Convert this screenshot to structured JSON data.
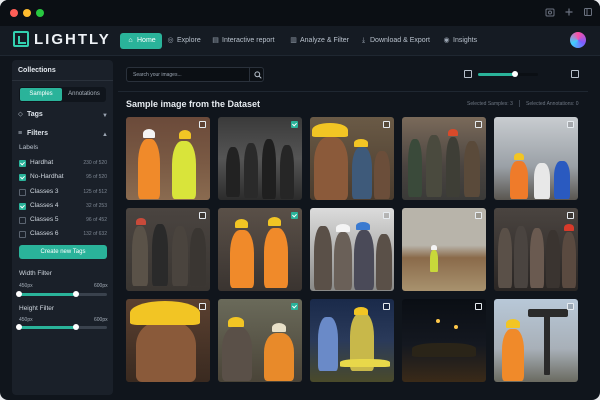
{
  "app": {
    "logo_text": "LIGHTLY",
    "accent_color": "#2ab39a"
  },
  "titlebar": {
    "dots": [
      "#ff5f57",
      "#febc2e",
      "#28c840"
    ],
    "icons": [
      "screenshot-icon",
      "plus-icon",
      "settings-icon"
    ]
  },
  "nav": {
    "items": [
      {
        "label": "Home",
        "icon": "home-icon",
        "active": true
      },
      {
        "label": "Explore",
        "icon": "compass-icon",
        "active": false
      },
      {
        "label": "Interactive report",
        "icon": "report-icon",
        "active": false
      },
      {
        "label": "Analyze & Filter",
        "icon": "bar-chart-icon",
        "active": false
      },
      {
        "label": "Download & Export",
        "icon": "download-icon",
        "active": false
      },
      {
        "label": "Insights",
        "icon": "eye-icon",
        "active": false
      }
    ]
  },
  "sidebar": {
    "title": "Collections",
    "tabs": [
      {
        "label": "Samples",
        "active": true
      },
      {
        "label": "Annotations",
        "active": false
      }
    ],
    "tags_label": "Tags",
    "filters_label": "Filters",
    "labels_heading": "Labels",
    "labels": [
      {
        "name": "Hardhat",
        "count": "230 of 520",
        "checked": true
      },
      {
        "name": "No-Hardhat",
        "count": "95 of 520",
        "checked": true
      },
      {
        "name": "Classes 3",
        "count": "125 of 512",
        "checked": false
      },
      {
        "name": "Classes 4",
        "count": "32 of 253",
        "checked": true
      },
      {
        "name": "Classes 5",
        "count": "96 of 452",
        "checked": false
      },
      {
        "name": "Classes 6",
        "count": "132 of 632",
        "checked": false
      }
    ],
    "create_tags_label": "Create new Tags",
    "width_filter": {
      "title": "Width Filter",
      "min": "450px",
      "max": "600px",
      "low": 0.0,
      "high": 0.65
    },
    "height_filter": {
      "title": "Height Filter",
      "min": "450px",
      "max": "600px",
      "low": 0.0,
      "high": 0.65
    }
  },
  "main": {
    "search_placeholder": "Search your images...",
    "zoom_level": 0.62,
    "section_title": "Sample image from the Dataset",
    "selected_samples": "Selected Samples: 3",
    "selected_annotations": "Selected Annotations: 0",
    "images": [
      {
        "name": "image-workers-hivis-site",
        "selected": false
      },
      {
        "name": "image-miners-black-white",
        "selected": true
      },
      {
        "name": "image-miner-portrait-yellow-hardhat",
        "selected": false
      },
      {
        "name": "image-miners-group-walking",
        "selected": false
      },
      {
        "name": "image-workers-meeting-outdoor",
        "selected": false
      },
      {
        "name": "image-miners-group-tunnel",
        "selected": false
      },
      {
        "name": "image-two-workers-orange-vests",
        "selected": true
      },
      {
        "name": "image-miners-group-closeup",
        "selected": false
      },
      {
        "name": "image-worker-quarry-landscape",
        "selected": false
      },
      {
        "name": "image-workers-crowd-site",
        "selected": false
      },
      {
        "name": "image-miner-portrait-closeup",
        "selected": false
      },
      {
        "name": "image-workers-machinery",
        "selected": true
      },
      {
        "name": "image-workers-tunnel-lights",
        "selected": false
      },
      {
        "name": "image-construction-night",
        "selected": false
      },
      {
        "name": "image-worker-oil-pump",
        "selected": false
      }
    ]
  }
}
